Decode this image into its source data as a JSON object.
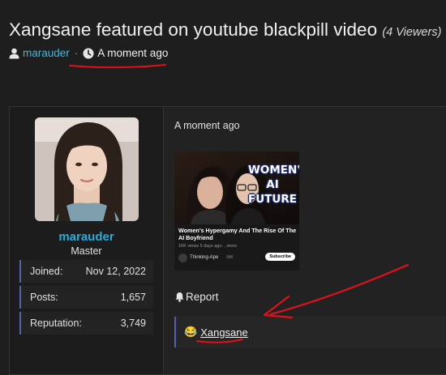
{
  "thread": {
    "title": "Xangsane featured on youtube blackpill video",
    "viewers": "(4 Viewers)",
    "author": "marauder",
    "separator": "·",
    "timestamp": "A moment ago"
  },
  "post": {
    "user": {
      "name": "marauder",
      "title": "Master",
      "stats": [
        {
          "label": "Joined:",
          "value": "Nov 12, 2022"
        },
        {
          "label": "Posts:",
          "value": "1,657"
        },
        {
          "label": "Reputation:",
          "value": "3,749"
        }
      ]
    },
    "date": "A moment ago",
    "video": {
      "thumb_text": "WOMEN'S AI FUTURE",
      "title": "Women's Hypergamy And The Rise Of The AI Boyfriend",
      "stats": "16K views  5 days ago  ...more",
      "channel": "Thinking-Ape",
      "subs": "99K",
      "subscribe": "Subscribe"
    },
    "report_label": "Report",
    "quote": {
      "emoji": "😂",
      "mention": "Xangsane"
    }
  },
  "colors": {
    "background": "#1e1e1e",
    "link": "#45b6d8",
    "username": "#2fa8d6",
    "accent_border": "#5b5fb0",
    "annotation": "#e0111b"
  }
}
